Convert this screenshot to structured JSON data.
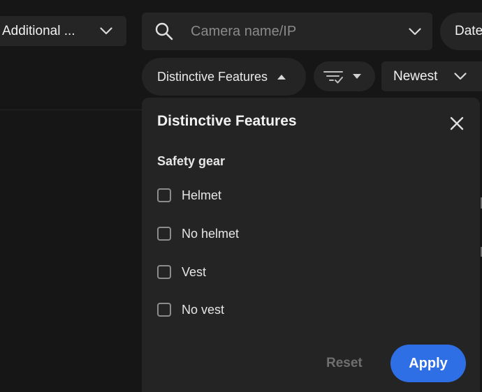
{
  "toolbar": {
    "additional_select_label": "Additional ...",
    "search_placeholder": "Camera name/IP",
    "date_label": "Date",
    "features_chip_label": "Distinctive Features",
    "sort_label": "Newest"
  },
  "panel": {
    "title": "Distinctive Features",
    "section_label": "Safety gear",
    "options": [
      {
        "label": "Helmet",
        "checked": false
      },
      {
        "label": "No helmet",
        "checked": false
      },
      {
        "label": "Vest",
        "checked": false
      },
      {
        "label": "No vest",
        "checked": false
      }
    ],
    "reset_label": "Reset",
    "apply_label": "Apply"
  },
  "colors": {
    "background": "#161616",
    "surface": "#252525",
    "accent": "#2f6fe5",
    "text": "#e6e6e6",
    "muted": "#6f6f6f"
  },
  "icons": [
    "search-icon",
    "chevron-down-icon",
    "caret-up-icon",
    "filter-icon",
    "caret-down-icon",
    "close-icon"
  ]
}
